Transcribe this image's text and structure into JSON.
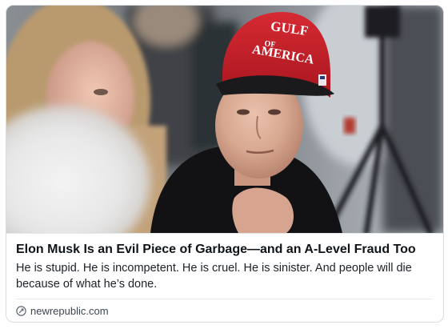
{
  "card": {
    "image": {
      "hat_text_line1": "GULF",
      "hat_text_line2": "AMERICA",
      "hat_text_of": "OF"
    },
    "headline": "Elon Musk Is an Evil Piece of Garbage—and an A-Level Fraud Too",
    "description": "He is stupid. He is incompetent. He is cruel. He is sinister. And people will die because of what he’s done.",
    "source": {
      "domain": "newrepublic.com",
      "icon": "link-icon"
    }
  },
  "colors": {
    "hat_red": "#c8202a",
    "headline_text": "#0f1419",
    "description_text": "#1c2228",
    "source_text": "#3d4650",
    "border": "#d9dde1"
  }
}
